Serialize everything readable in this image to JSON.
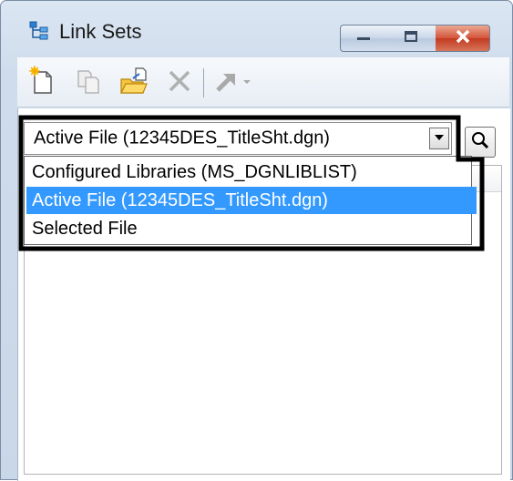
{
  "window": {
    "title": "Link Sets",
    "icon": "link-sets-tree-icon",
    "caption_buttons": [
      "minimize-icon",
      "maximize-icon",
      "close-icon"
    ]
  },
  "toolbar": {
    "items": [
      {
        "icon": "new-link-set-icon",
        "enabled": true
      },
      {
        "icon": "copy-link-set-icon",
        "enabled": false
      },
      {
        "icon": "open-folder-link-icon",
        "enabled": true
      },
      {
        "icon": "delete-icon",
        "enabled": false
      },
      {
        "icon": "insert-arrow-icon",
        "enabled": false
      },
      {
        "icon": "chevron-down-icon",
        "enabled": false
      }
    ]
  },
  "source_combo": {
    "value": "Active File (12345DES_TitleSht.dgn)",
    "options": [
      "Configured Libraries (MS_DGNLIBLIST)",
      "Active File (12345DES_TitleSht.dgn)",
      "Selected File"
    ],
    "selected_index": 1
  },
  "colors": {
    "selection": "#3399ff",
    "close_button": "#c23a20",
    "highlight_frame": "#000000"
  }
}
